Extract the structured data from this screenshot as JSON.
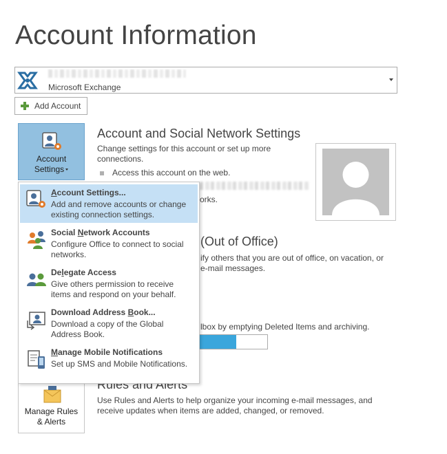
{
  "page": {
    "title": "Account Information"
  },
  "account_selector": {
    "type": "Microsoft Exchange",
    "email_blurred": ""
  },
  "add_account": {
    "label": "Add Account"
  },
  "account_settings_tile": {
    "label_line1": "Account",
    "label_line2": "Settings"
  },
  "account_settings_section": {
    "title": "Account and Social Network Settings",
    "desc": "Change settings for this account or set up more connections.",
    "bullet": "Access this account on the web.",
    "partial_text": "orks."
  },
  "menu": {
    "items": [
      {
        "title_pre": "",
        "title_ul": "A",
        "title_post": "ccount Settings...",
        "desc": "Add and remove accounts or change existing connection settings.",
        "icon": "account-settings-icon"
      },
      {
        "title_pre": "Social ",
        "title_ul": "N",
        "title_post": "etwork Accounts",
        "desc": "Configure Office to connect to social networks.",
        "icon": "social-network-icon"
      },
      {
        "title_pre": "De",
        "title_ul": "l",
        "title_post": "egate Access",
        "desc": "Give others permission to receive items and respond on your behalf.",
        "icon": "delegate-icon"
      },
      {
        "title_pre": "Download Address ",
        "title_ul": "B",
        "title_post": "ook...",
        "desc": "Download a copy of the Global Address Book.",
        "icon": "address-book-icon"
      },
      {
        "title_pre": "",
        "title_ul": "M",
        "title_post": "anage Mobile Notifications",
        "desc": "Set up SMS and Mobile Notifications.",
        "icon": "mobile-notification-icon"
      }
    ]
  },
  "automatic_replies_section": {
    "title_partial": "(Out of Office)",
    "desc_a": "ify others that you are out of office, on vacation, or",
    "desc_b": "e-mail messages."
  },
  "mailbox_section": {
    "desc_partial": "lbox by emptying Deleted Items and archiving.",
    "usage_fraction": 0.56,
    "bar_color": "#3aa6dc"
  },
  "rules_tile": {
    "label_line1": "Manage Rules",
    "label_line2": "& Alerts"
  },
  "rules_section": {
    "title": "Rules and Alerts",
    "desc": "Use Rules and Alerts to help organize your incoming e-mail messages, and receive updates when items are added, changed, or removed."
  },
  "colors": {
    "tile_selected": "#92c0e0",
    "menu_selected": "#c5e0f5",
    "accent_green": "#5b9a3c"
  }
}
